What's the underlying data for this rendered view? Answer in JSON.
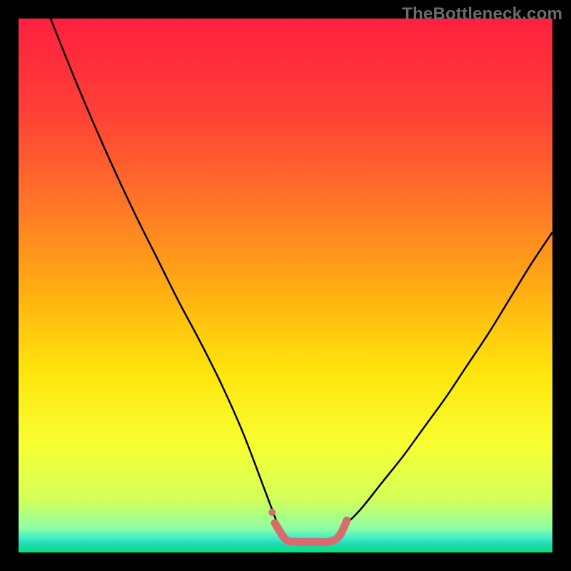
{
  "watermark": {
    "text": "TheBottleneck.com"
  },
  "chart_data": {
    "type": "line",
    "title": "",
    "xlabel": "",
    "ylabel": "",
    "xlim": [
      0,
      100
    ],
    "ylim": [
      0,
      100
    ],
    "gradient_stops": [
      {
        "offset": 0.0,
        "color": "#ff203f"
      },
      {
        "offset": 0.18,
        "color": "#ff4136"
      },
      {
        "offset": 0.36,
        "color": "#ff7a26"
      },
      {
        "offset": 0.52,
        "color": "#ffb211"
      },
      {
        "offset": 0.66,
        "color": "#ffe40c"
      },
      {
        "offset": 0.8,
        "color": "#f7ff32"
      },
      {
        "offset": 0.9,
        "color": "#d4ff5a"
      },
      {
        "offset": 0.955,
        "color": "#8dffa4"
      },
      {
        "offset": 0.975,
        "color": "#38eccb"
      },
      {
        "offset": 0.985,
        "color": "#1fd8b0"
      },
      {
        "offset": 1.0,
        "color": "#00e57a"
      }
    ],
    "series": [
      {
        "name": "left-arm",
        "stroke": "#000000",
        "width": 2.5,
        "x": [
          6,
          10,
          14,
          18,
          22,
          26,
          30,
          34,
          38,
          42,
          46,
          49
        ],
        "y": [
          100,
          90,
          80.5,
          71.5,
          63,
          55,
          47,
          39.5,
          31.5,
          22.5,
          12,
          4
        ]
      },
      {
        "name": "right-arm",
        "stroke": "#000000",
        "width": 2.5,
        "x": [
          60,
          64,
          68,
          72,
          76,
          80,
          84,
          88,
          92,
          96,
          100
        ],
        "y": [
          4,
          8,
          13,
          18,
          23.5,
          29,
          35,
          41,
          47.5,
          54,
          60
        ]
      },
      {
        "name": "bottom-highlight",
        "stroke": "#d76b6d",
        "width": 11,
        "linecap": "round",
        "x": [
          48,
          50,
          52,
          55,
          58,
          60,
          61.5
        ],
        "y": [
          5.5,
          2.5,
          2.0,
          2.0,
          2.0,
          3.0,
          6.0
        ]
      }
    ],
    "markers": [
      {
        "x": 47.5,
        "y": 7.5,
        "r": 5,
        "color": "#d76b6d"
      }
    ]
  }
}
